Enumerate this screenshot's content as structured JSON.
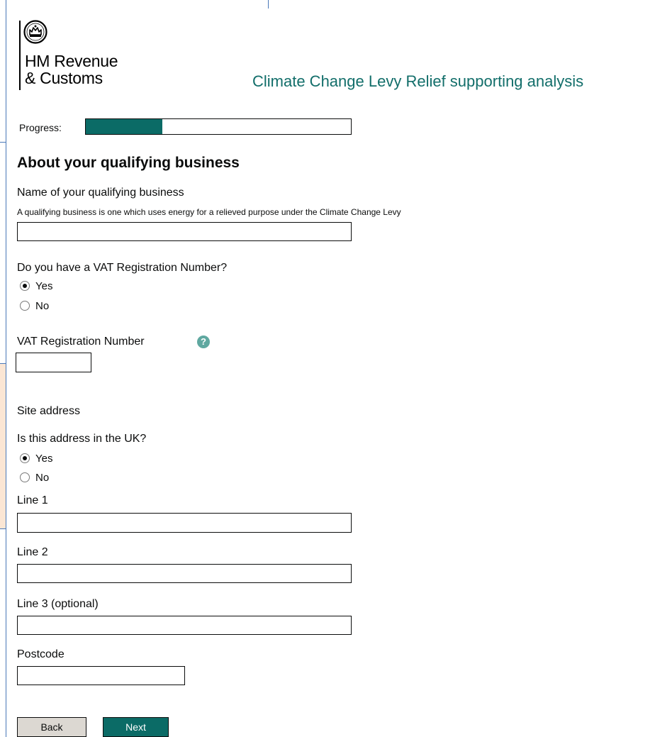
{
  "header": {
    "logo_line1": "HM Revenue",
    "logo_line2": "& Customs",
    "crest_icon": "royal-crest-icon",
    "app_title": "Climate Change Levy Relief supporting analysis"
  },
  "progress": {
    "label": "Progress:",
    "value_fraction": 0.29,
    "fill_color": "#0b6b66"
  },
  "form": {
    "heading": "About your qualifying business",
    "business_name": {
      "label": "Name of your qualifying business",
      "hint": "A qualifying business is one which uses energy for a relieved purpose under the Climate Change Levy",
      "value": ""
    },
    "vat_question": {
      "label": "Do you have a VAT Registration Number?",
      "options": [
        "Yes",
        "No"
      ],
      "selected": "Yes"
    },
    "vat_number": {
      "label": "VAT Registration Number",
      "help_icon": "question-mark-icon",
      "help_glyph": "?",
      "value": ""
    },
    "site_address": {
      "heading": "Site address",
      "uk_question": {
        "label": "Is this address in the UK?",
        "options": [
          "Yes",
          "No"
        ],
        "selected": "Yes"
      },
      "line1_label": "Line 1",
      "line2_label": "Line 2",
      "line3_label": "Line 3 (optional)",
      "postcode_label": "Postcode"
    }
  },
  "buttons": {
    "back": "Back",
    "next": "Next"
  },
  "colors": {
    "brand_teal": "#0b6b66",
    "title_teal": "#126e6a"
  }
}
